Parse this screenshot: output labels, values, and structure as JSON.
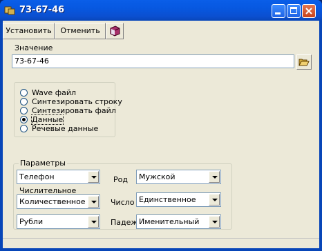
{
  "window": {
    "title": "73-67-46"
  },
  "toolbar": {
    "set_label": "Установить",
    "cancel_label": "Отменить",
    "book_icon": "book-icon"
  },
  "value_section": {
    "label": "Значение",
    "value": "73-67-46"
  },
  "radio_group": {
    "options": [
      "Wave файл",
      "Синтезировать строку",
      "Синтезировать файл",
      "Данные",
      "Речевые данные"
    ],
    "selected": "Данные"
  },
  "params": {
    "title": "Параметры",
    "type_combo": "Телефон",
    "numeral_label": "Числительное",
    "numeral_combo": "Количественное ч.",
    "currency_combo": "Рубли",
    "gender_label": "Род",
    "gender_combo": "Мужской",
    "number_label": "Число",
    "number_combo": "Единственное",
    "case_label": "Падеж",
    "case_combo": "Именительный"
  }
}
